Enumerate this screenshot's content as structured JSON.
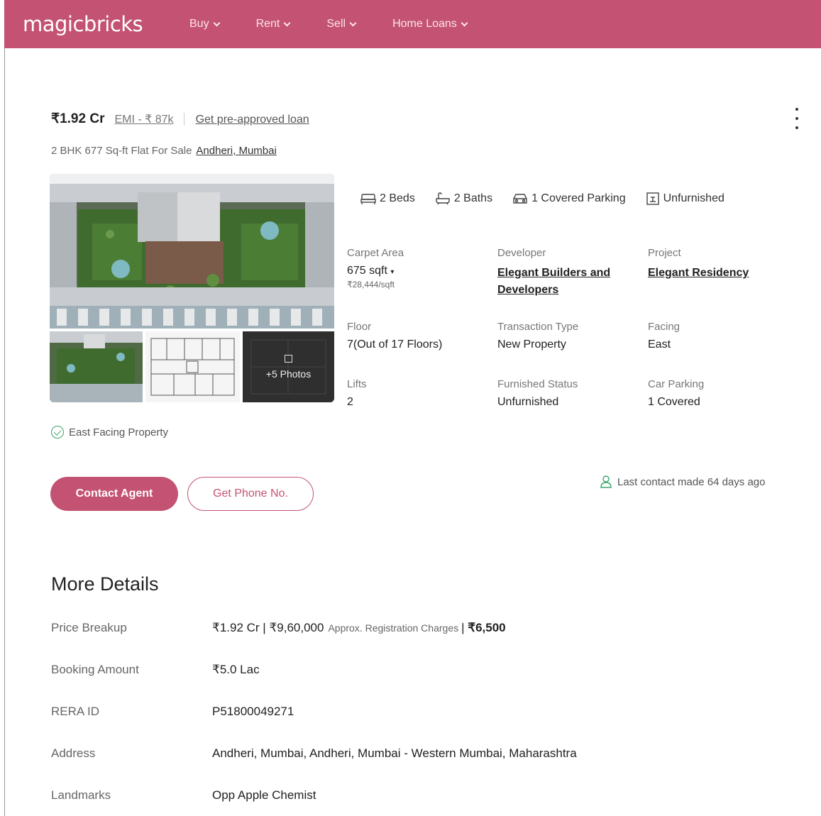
{
  "header": {
    "logo": "magicbricks",
    "nav": [
      {
        "label": "Buy"
      },
      {
        "label": "Rent"
      },
      {
        "label": "Sell"
      },
      {
        "label": "Home Loans"
      }
    ]
  },
  "listing": {
    "price": "₹1.92 Cr",
    "emi": "EMI - ₹ 87k",
    "loan_link": "Get pre-approved loan",
    "subtitle": "2 BHK 677 Sq-ft Flat For Sale",
    "location": "Andheri, Mumbai",
    "photos_more": "+5 Photos",
    "amenities": {
      "beds": "2 Beds",
      "baths": "2 Baths",
      "parking": "1 Covered Parking",
      "furnishing": "Unfurnished"
    },
    "specs": {
      "carpet_area_label": "Carpet Area",
      "carpet_area_value": "675 sqft",
      "carpet_area_rate": "₹28,444/sqft",
      "developer_label": "Developer",
      "developer_value": "Elegant Builders and Developers",
      "project_label": "Project",
      "project_value": "Elegant Residency",
      "floor_label": "Floor",
      "floor_value": "7(Out of 17 Floors)",
      "transaction_label": "Transaction Type",
      "transaction_value": "New Property",
      "facing_label": "Facing",
      "facing_value": "East",
      "lifts_label": "Lifts",
      "lifts_value": "2",
      "furnished_label": "Furnished Status",
      "furnished_value": "Unfurnished",
      "car_parking_label": "Car Parking",
      "car_parking_value": "1 Covered"
    },
    "facing_note": "East Facing Property",
    "contact_button": "Contact Agent",
    "phone_button": "Get Phone No.",
    "last_contact": "Last contact made 64 days ago"
  },
  "more_details": {
    "title": "More Details",
    "price_breakup_label": "Price Breakup",
    "price_breakup_price": "₹1.92 Cr",
    "price_breakup_charges": "₹9,60,000",
    "price_breakup_reg_label": "Approx. Registration Charges",
    "price_breakup_reg_value": "₹6,500",
    "booking_label": "Booking Amount",
    "booking_value": "₹5.0 Lac",
    "rera_label": "RERA ID",
    "rera_value": "P51800049271",
    "address_label": "Address",
    "address_value": "Andheri, Mumbai, Andheri, Mumbai - Western Mumbai, Maharashtra",
    "landmarks_label": "Landmarks",
    "landmarks_value": "Opp Apple Chemist"
  },
  "colors": {
    "brand": "#c45273",
    "success": "#3aa56b"
  }
}
